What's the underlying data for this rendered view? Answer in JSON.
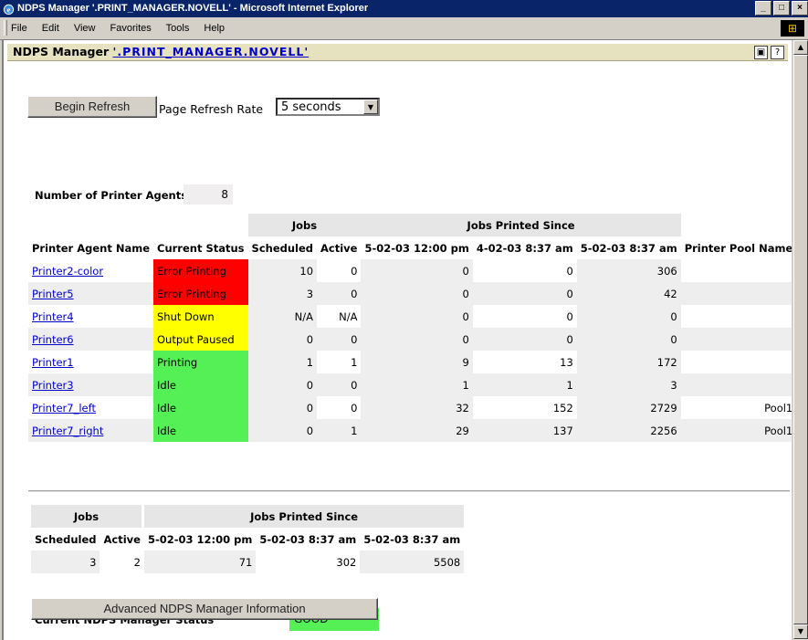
{
  "window": {
    "title": "NDPS Manager '.PRINT_MANAGER.NOVELL' - Microsoft Internet Explorer",
    "minimize": "_",
    "maximize": "□",
    "close": "×"
  },
  "menu": [
    "File",
    "Edit",
    "View",
    "Favorites",
    "Tools",
    "Help"
  ],
  "header": {
    "prefix": "NDPS Manager",
    "link": "'.PRINT_MANAGER.NOVELL'"
  },
  "controls": {
    "refresh_button": "Begin Refresh",
    "refresh_rate_label": "Page Refresh Rate",
    "refresh_rate_value": "5 seconds"
  },
  "agents_count": {
    "label": "Number of Printer Agents",
    "value": "8"
  },
  "agents_table": {
    "group_headers": {
      "jobs": "Jobs",
      "printed_since": "Jobs Printed Since"
    },
    "columns": [
      "Printer Agent Name",
      "Current Status",
      "Scheduled",
      "Active",
      "5-02-03 12:00 pm",
      "4-02-03 8:37 am",
      "5-02-03 8:37 am",
      "Printer Pool Name"
    ],
    "rows": [
      {
        "name": "Printer2-color",
        "status": "Error Printing",
        "color": "#ff0000",
        "scheduled": "10",
        "active": "0",
        "p1": "0",
        "p2": "0",
        "p3": "306",
        "pool": ""
      },
      {
        "name": "Printer5",
        "status": "Error Printing",
        "color": "#ff0000",
        "scheduled": "3",
        "active": "0",
        "p1": "0",
        "p2": "0",
        "p3": "42",
        "pool": ""
      },
      {
        "name": "Printer4",
        "status": "Shut Down",
        "color": "#ffff00",
        "scheduled": "N/A",
        "active": "N/A",
        "p1": "0",
        "p2": "0",
        "p3": "0",
        "pool": ""
      },
      {
        "name": "Printer6",
        "status": "Output Paused",
        "color": "#ffff00",
        "scheduled": "0",
        "active": "0",
        "p1": "0",
        "p2": "0",
        "p3": "0",
        "pool": ""
      },
      {
        "name": "Printer1",
        "status": "Printing",
        "color": "#55f055",
        "scheduled": "1",
        "active": "1",
        "p1": "9",
        "p2": "13",
        "p3": "172",
        "pool": ""
      },
      {
        "name": "Printer3",
        "status": "Idle",
        "color": "#55f055",
        "scheduled": "0",
        "active": "0",
        "p1": "1",
        "p2": "1",
        "p3": "3",
        "pool": ""
      },
      {
        "name": "Printer7_left",
        "status": "Idle",
        "color": "#55f055",
        "scheduled": "0",
        "active": "0",
        "p1": "32",
        "p2": "152",
        "p3": "2729",
        "pool": "Pool1"
      },
      {
        "name": "Printer7_right",
        "status": "Idle",
        "color": "#55f055",
        "scheduled": "0",
        "active": "1",
        "p1": "29",
        "p2": "137",
        "p3": "2256",
        "pool": "Pool1"
      }
    ]
  },
  "totals_table": {
    "group_headers": {
      "jobs": "Jobs",
      "printed_since": "Jobs Printed Since"
    },
    "columns": [
      "Scheduled",
      "Active",
      "5-02-03 12:00 pm",
      "5-02-03 8:37 am",
      "5-02-03 8:37 am"
    ],
    "values": [
      "3",
      "2",
      "71",
      "302",
      "5508"
    ]
  },
  "manager_status": {
    "label": "Current NDPS Manager Status",
    "value": "GOOD",
    "color": "#55f055"
  },
  "advanced_button": "Advanced NDPS Manager Information"
}
